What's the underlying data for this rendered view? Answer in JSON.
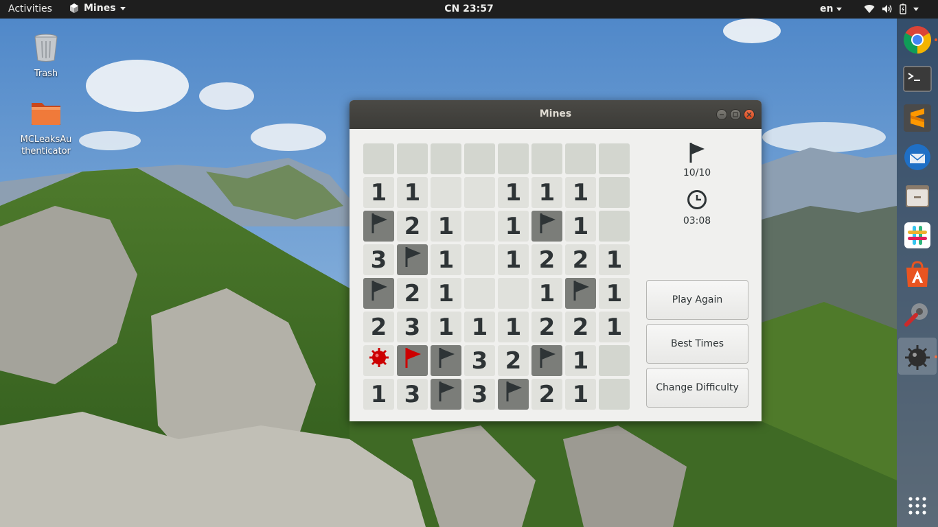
{
  "topbar": {
    "activities": "Activities",
    "app_name": "Mines",
    "clock": "CN 23:57",
    "language": "en"
  },
  "desktop": {
    "icons": [
      {
        "label": "Trash",
        "icon": "trash-icon"
      },
      {
        "label": "MCLeaksAuthenticator",
        "label_line1": "MCLeaksAu",
        "label_line2": "thenticator",
        "icon": "folder-icon"
      }
    ]
  },
  "dock": {
    "apps": [
      "chrome-icon",
      "terminal-icon",
      "sublime-text-icon",
      "thunderbird-icon",
      "files-icon",
      "slack-icon",
      "ubuntu-software-icon",
      "system-tools-icon",
      "mines-icon"
    ],
    "show_apps": "show-applications-icon"
  },
  "window": {
    "title": "Mines",
    "flags": "10/10",
    "time": "03:08",
    "buttons": {
      "play_again": "Play Again",
      "best_times": "Best Times",
      "change_difficulty": "Change Difficulty"
    }
  },
  "board": {
    "rows": 8,
    "cols": 8,
    "legend": "C = covered, E = empty open, F = flag, R = red flag (wrong), M = exploded mine, digit = count",
    "grid": [
      [
        "C",
        "C",
        "C",
        "C",
        "C",
        "C",
        "C",
        "C"
      ],
      [
        "1",
        "1",
        "E",
        "E",
        "1",
        "1",
        "1",
        "C"
      ],
      [
        "F",
        "2",
        "1",
        "E",
        "1",
        "F",
        "1",
        "C"
      ],
      [
        "3",
        "F",
        "1",
        "E",
        "1",
        "2",
        "2",
        "1"
      ],
      [
        "F",
        "2",
        "1",
        "E",
        "E",
        "1",
        "F",
        "1"
      ],
      [
        "2",
        "3",
        "1",
        "1",
        "1",
        "2",
        "2",
        "1"
      ],
      [
        "M",
        "R",
        "F",
        "3",
        "2",
        "F",
        "1",
        "C"
      ],
      [
        "1",
        "3",
        "F",
        "3",
        "F",
        "2",
        "1",
        "C"
      ]
    ]
  },
  "colors": {
    "topbar": "#1e1e1e",
    "titlebar": "#3c3b37",
    "close_button": "#e05a2b",
    "flag_cell": "#7b7d79",
    "covered_cell": "#d3d6cf",
    "open_cell": "#e0e1dc",
    "mine": "#cc0000",
    "accent": "#e95420"
  }
}
